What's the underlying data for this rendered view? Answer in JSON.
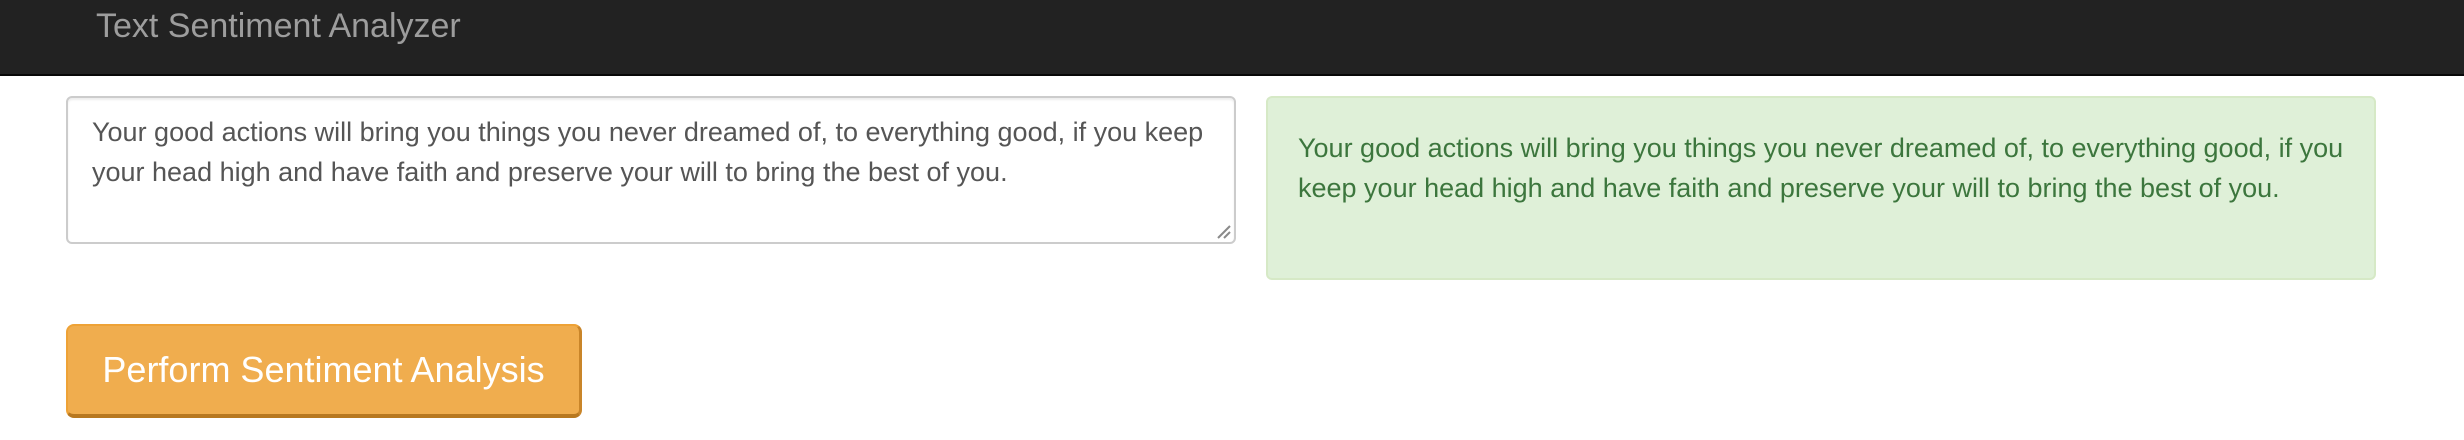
{
  "navbar": {
    "brand": "Text Sentiment Analyzer",
    "background": "#222222",
    "brand_color": "#9d9d9d"
  },
  "input": {
    "value": "Your good actions will bring you things you never dreamed of, to everything good, if you keep your head high and have faith and preserve your will to bring the best of you."
  },
  "result": {
    "text": "Your good actions will bring you things you never dreamed of, to everything good, if you keep your head high and have faith and preserve your will to bring the best of you.",
    "background": "#dff0d8",
    "text_color": "#3c763d"
  },
  "actions": {
    "analyze_label": "Perform Sentiment Analysis",
    "button_color": "#f0ad4e"
  }
}
